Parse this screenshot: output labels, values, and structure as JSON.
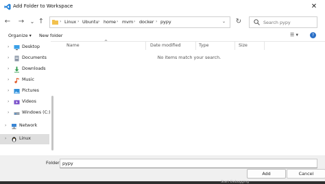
{
  "window": {
    "title": "Add Folder to Workspace",
    "close_glyph": "✕"
  },
  "nav": {
    "back_glyph": "←",
    "forward_glyph": "→",
    "recent_glyph": "⌄",
    "up_glyph": "↑"
  },
  "address": {
    "path": [
      "Linux",
      "Ubuntu",
      "home",
      "mvm",
      "docker",
      "pypy"
    ],
    "separator": "›",
    "leading_separator": "›",
    "dropdown_glyph": "⌄",
    "refresh_glyph": "↻"
  },
  "search": {
    "placeholder": "Search pypy"
  },
  "toolbar": {
    "organize_label": "Organize ▾",
    "new_folder_label": "New folder",
    "view_glyph": "☰ ▾",
    "help_glyph": "?"
  },
  "sidebar": {
    "items": [
      {
        "label": "Desktop",
        "icon": "desktop-icon",
        "selected": false
      },
      {
        "label": "Documents",
        "icon": "documents-icon",
        "selected": false
      },
      {
        "label": "Downloads",
        "icon": "downloads-icon",
        "selected": false
      },
      {
        "label": "Music",
        "icon": "music-icon",
        "selected": false
      },
      {
        "label": "Pictures",
        "icon": "pictures-icon",
        "selected": false
      },
      {
        "label": "Videos",
        "icon": "videos-icon",
        "selected": false
      },
      {
        "label": "Windows (C:)",
        "icon": "drive-icon",
        "selected": false
      },
      {
        "label": "Network",
        "icon": "network-icon",
        "selected": false
      },
      {
        "label": "Linux",
        "icon": "linux-icon",
        "selected": true
      }
    ],
    "chevron_glyph": "›"
  },
  "file_list": {
    "columns": [
      "Name",
      "Date modified",
      "Type",
      "Size"
    ],
    "sort_glyph": "^",
    "empty_message": "No items match your search."
  },
  "footer": {
    "folder_label": "Folder:",
    "folder_value": "pypy",
    "add_label": "Add",
    "cancel_label": "Cancel"
  },
  "taskbar": {
    "text": "Start Debugging"
  },
  "colors": {
    "accent": "#1e7fd8",
    "folder": "#f2c14e"
  }
}
